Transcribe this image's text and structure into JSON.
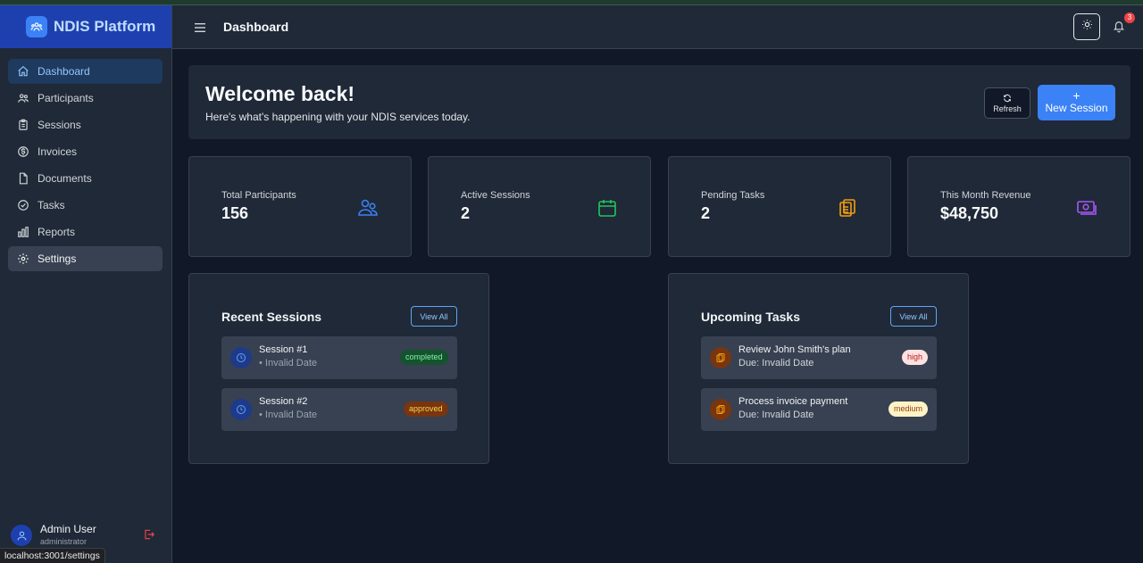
{
  "brand": {
    "name": "NDIS Platform"
  },
  "sidebar": {
    "items": [
      {
        "label": "Dashboard",
        "icon": "home-icon"
      },
      {
        "label": "Participants",
        "icon": "users-icon"
      },
      {
        "label": "Sessions",
        "icon": "clipboard-icon"
      },
      {
        "label": "Invoices",
        "icon": "dollar-icon"
      },
      {
        "label": "Documents",
        "icon": "file-icon"
      },
      {
        "label": "Tasks",
        "icon": "check-circle-icon"
      },
      {
        "label": "Reports",
        "icon": "bar-chart-icon"
      },
      {
        "label": "Settings",
        "icon": "gear-icon"
      }
    ],
    "active": "Dashboard",
    "hovered": "Settings",
    "user": {
      "name": "Admin User",
      "role": "administrator"
    }
  },
  "status_url": "localhost:3001/settings",
  "header": {
    "title": "Dashboard",
    "notification_count": "3"
  },
  "welcome": {
    "title": "Welcome back!",
    "subtitle": "Here's what's happening with your NDIS services today.",
    "refresh_label": "Refresh",
    "new_session_label": "New Session"
  },
  "stats": [
    {
      "label": "Total Participants",
      "value": "156",
      "icon": "users-icon",
      "color": "#3b82f6"
    },
    {
      "label": "Active Sessions",
      "value": "2",
      "icon": "calendar-icon",
      "color": "#22c55e"
    },
    {
      "label": "Pending Tasks",
      "value": "2",
      "icon": "clipboard-icon",
      "color": "#f59e0b"
    },
    {
      "label": "This Month Revenue",
      "value": "$48,750",
      "icon": "cash-icon",
      "color": "#a855f7"
    }
  ],
  "recent_sessions": {
    "title": "Recent Sessions",
    "view_all": "View All",
    "items": [
      {
        "title": "Session #1",
        "subtitle": "• Invalid Date",
        "status": "completed"
      },
      {
        "title": "Session #2",
        "subtitle": "• Invalid Date",
        "status": "approved"
      }
    ]
  },
  "upcoming_tasks": {
    "title": "Upcoming Tasks",
    "view_all": "View All",
    "items": [
      {
        "title": "Review John Smith's plan",
        "subtitle": "Due: Invalid Date",
        "priority": "high"
      },
      {
        "title": "Process invoice payment",
        "subtitle": "Due: Invalid Date",
        "priority": "medium"
      }
    ]
  },
  "colors": {
    "accent": "#3b82f6",
    "completed": "#166534",
    "approved": "#92400e",
    "high": "#fee2e2",
    "medium": "#fef3c7"
  }
}
